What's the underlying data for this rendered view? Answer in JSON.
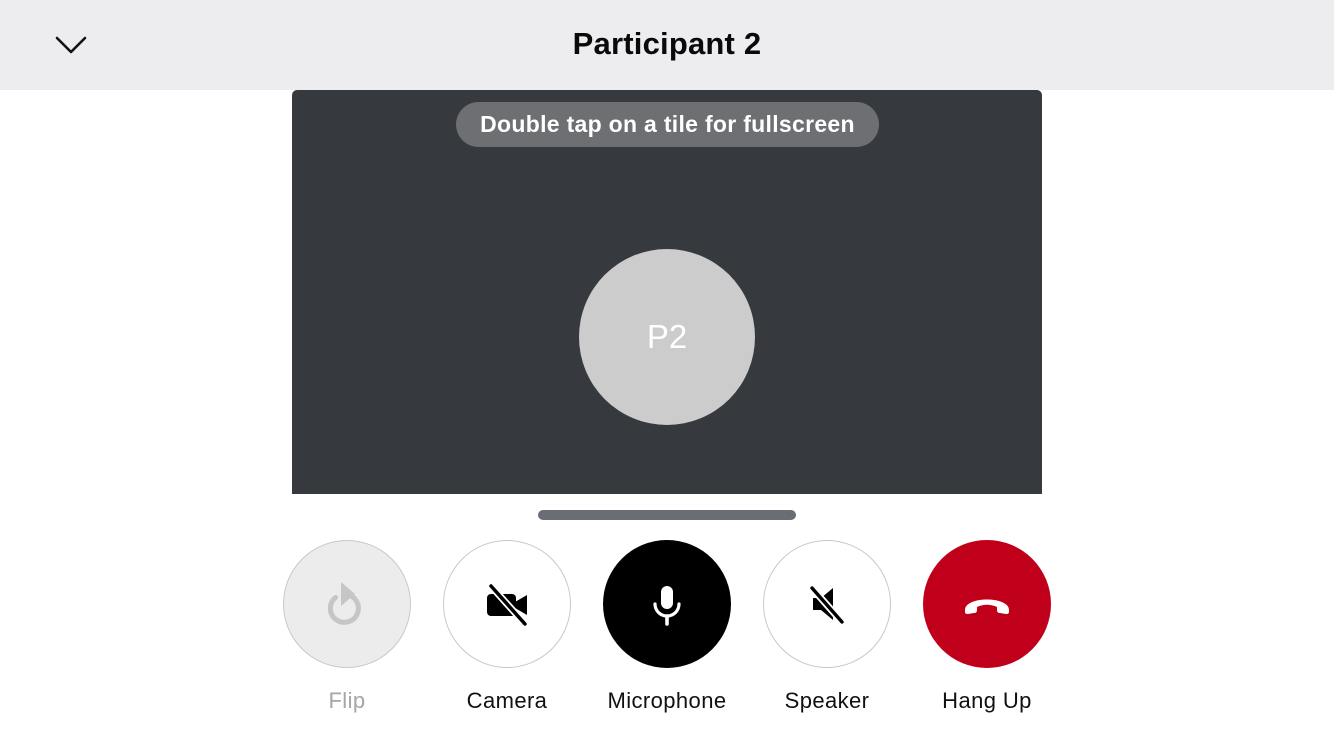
{
  "header": {
    "title": "Participant 2",
    "background": "#ededef",
    "collapse_icon": "chevron-down-icon"
  },
  "video_tile": {
    "hint": "Double tap on a tile for fullscreen",
    "avatar_initials": "P2",
    "background": "#36393d"
  },
  "controls": {
    "flip": {
      "label": "Flip",
      "icon": "flip-camera-icon",
      "enabled": false
    },
    "camera": {
      "label": "Camera",
      "icon": "video-off-icon",
      "state": "off"
    },
    "microphone": {
      "label": "Microphone",
      "icon": "microphone-icon",
      "state": "on"
    },
    "speaker": {
      "label": "Speaker",
      "icon": "speaker-muted-icon",
      "state": "off"
    },
    "hangup": {
      "label": "Hang Up",
      "icon": "hang-up-icon",
      "color": "#c0001b"
    }
  }
}
